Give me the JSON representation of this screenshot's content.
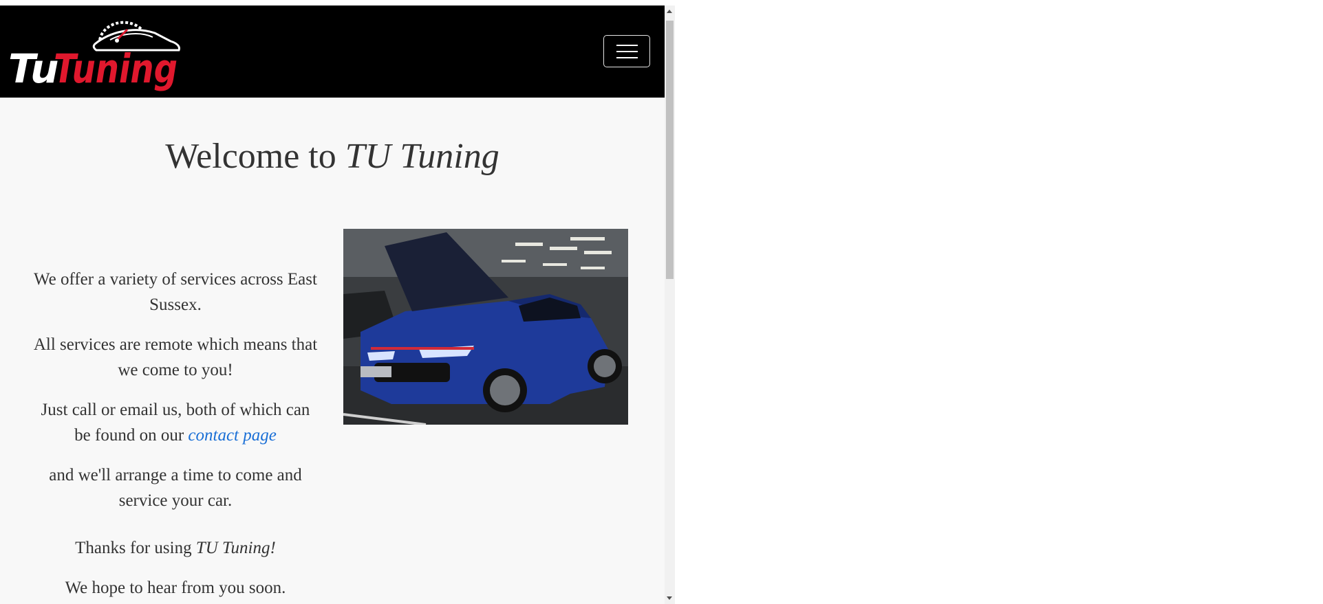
{
  "brand": {
    "logo_word1": "Tu",
    "logo_word2": "Tuning",
    "logo_color_primary": "#ffffff",
    "logo_color_accent": "#e0182d"
  },
  "navbar": {
    "background": "#000000",
    "toggle_icon": "hamburger-menu-icon"
  },
  "main": {
    "title_prefix": "Welcome to ",
    "title_brand": "TU Tuning",
    "paragraphs": {
      "p1": "We offer a variety of services across East Sussex.",
      "p2": "All services are remote which means that we come to you!",
      "p3_prefix": "Just call or email us, both of which can be found on our ",
      "p3_link": "contact page",
      "p4": "and we'll arrange a time to come and service your car.",
      "p5_prefix": "Thanks for using ",
      "p5_brand": "TU Tuning!",
      "p6": "We hope to hear from you soon."
    },
    "image_alt": "Blue hatchback with bonnet open in a car park",
    "link_color": "#1a6fd6"
  }
}
